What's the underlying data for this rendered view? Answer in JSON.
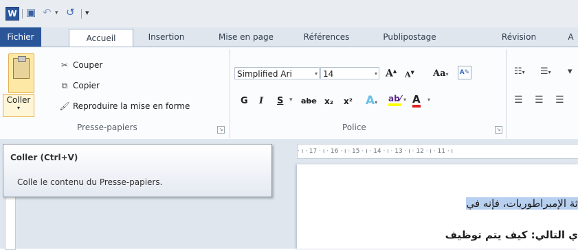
{
  "tabs": {
    "file": "Fichier",
    "items": [
      "Accueil",
      "Insertion",
      "Mise en page",
      "Références",
      "Publipostage",
      "Révision",
      "A"
    ]
  },
  "clipboard": {
    "paste": "Coller",
    "cut": "Couper",
    "copy": "Copier",
    "format_painter": "Reproduire la mise en forme",
    "group_label": "Presse-papiers"
  },
  "font": {
    "name": "Simplified Ari",
    "size": "14",
    "group_label": "Police",
    "bold": "G",
    "italic": "I",
    "underline": "S",
    "strike": "abe",
    "subscript": "x₂",
    "superscript": "x²",
    "grow": "A",
    "shrink": "A",
    "case": "Aa"
  },
  "ruler": {
    "marks": "· ı · 17 · ı · 16 · ı · 15 · ı · 14 · ı · 13 · ı · 12 · ı · 11 · ı"
  },
  "document": {
    "line1": "ثة الإمبراطوريات، فإنه في",
    "line2": "ي التالي: كيف يتم توظيف"
  },
  "tooltip": {
    "title": "Coller (Ctrl+V)",
    "description": "Colle le contenu du Presse-papiers."
  },
  "colors": {
    "accent": "#2a5699",
    "highlight": "#b8d0ef"
  }
}
